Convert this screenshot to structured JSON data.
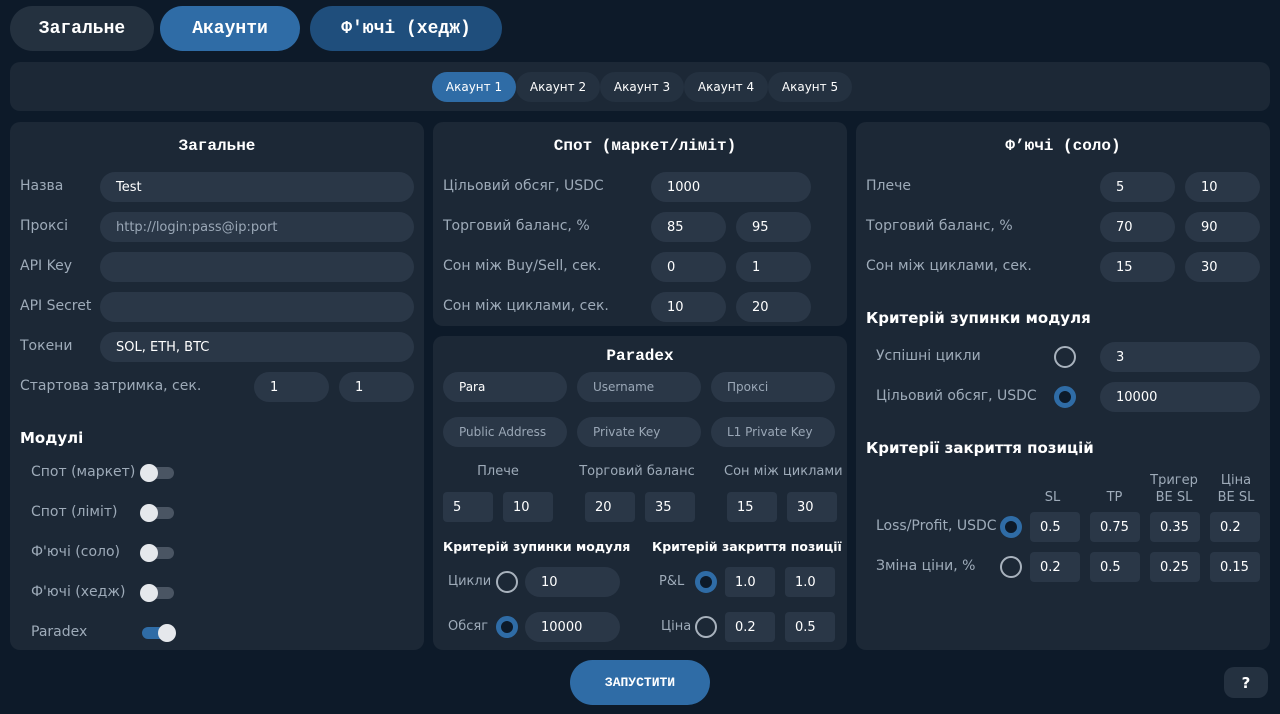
{
  "tabs": {
    "general": "Загальне",
    "accounts": "Акаунти",
    "futures_hedge": "Ф'ючі (хедж)"
  },
  "account_tabs": [
    "Акаунт 1",
    "Акаунт 2",
    "Акаунт 3",
    "Акаунт 4",
    "Акаунт 5"
  ],
  "general": {
    "title": "Загальне",
    "name_label": "Назва",
    "name_value": "Test",
    "proxy_label": "Проксі",
    "proxy_placeholder": "http://login:pass@ip:port",
    "api_key_label": "API Key",
    "api_key_value": "",
    "api_secret_label": "API Secret",
    "api_secret_value": "",
    "tokens_label": "Токени",
    "tokens_value": "SOL, ETH, BTC",
    "start_delay_label": "Стартова затримка, сек.",
    "start_delay_min": "1",
    "start_delay_max": "1",
    "modules_title": "Модулі",
    "modules": [
      {
        "label": "Спот (маркет)",
        "on": false
      },
      {
        "label": "Спот (ліміт)",
        "on": false
      },
      {
        "label": "Ф'ючі (соло)",
        "on": false
      },
      {
        "label": "Ф'ючі (хедж)",
        "on": false
      },
      {
        "label": "Paradex",
        "on": true
      }
    ]
  },
  "spot": {
    "title": "Спот (маркет/ліміт)",
    "target_volume_label": "Цільовий обсяг, USDC",
    "target_volume": "1000",
    "trade_balance_label": "Торговий баланс, %",
    "trade_balance_min": "85",
    "trade_balance_max": "95",
    "sleep_buy_sell_label": "Сон між Buy/Sell, сек.",
    "sleep_buy_sell_min": "0",
    "sleep_buy_sell_max": "1",
    "sleep_cycles_label": "Сон між циклами, сек.",
    "sleep_cycles_min": "10",
    "sleep_cycles_max": "20"
  },
  "paradex": {
    "title": "Paradex",
    "para_placeholder": "Para",
    "username_placeholder": "Username",
    "proxy_placeholder": "Проксі",
    "public_address_placeholder": "Public Address",
    "private_key_placeholder": "Private Key",
    "l1_private_key_placeholder": "L1 Private Key",
    "leverage_label": "Плече",
    "leverage_min": "5",
    "leverage_max": "10",
    "trade_balance_label": "Торговий баланс",
    "trade_balance_min": "20",
    "trade_balance_max": "35",
    "sleep_label": "Сон між циклами",
    "sleep_min": "15",
    "sleep_max": "30",
    "stop_title": "Критерій зупинки модуля",
    "cycles_label": "Цикли",
    "cycles_value": "10",
    "volume_label": "Обсяг",
    "volume_value": "10000",
    "close_title": "Критерій закриття позиції",
    "pnl_label": "P&L",
    "pnl_min": "1.0",
    "pnl_max": "1.0",
    "price_label": "Ціна",
    "price_min": "0.2",
    "price_max": "0.5"
  },
  "futures": {
    "title": "Ф’ючі (соло)",
    "leverage_label": "Плече",
    "leverage_min": "5",
    "leverage_max": "10",
    "trade_balance_label": "Торговий баланс, %",
    "trade_balance_min": "70",
    "trade_balance_max": "90",
    "sleep_label": "Сон між циклами, сек.",
    "sleep_min": "15",
    "sleep_max": "30",
    "stop_title": "Критерій зупинки модуля",
    "success_cycles_label": "Успішні цикли",
    "success_cycles_value": "3",
    "target_volume_label": "Цільовий обсяг, USDC",
    "target_volume_value": "10000",
    "close_title": "Критерії закриття позицій",
    "col_sl": "SL",
    "col_tp": "TP",
    "col_trigger_line1": "Тригер",
    "col_trigger_line2": "BE SL",
    "col_price_line1": "Ціна",
    "col_price_line2": "BE SL",
    "loss_profit_label": "Loss/Profit, USDC",
    "lp_sl": "0.5",
    "lp_tp": "0.75",
    "lp_trigger": "0.35",
    "lp_price": "0.2",
    "price_change_label": "Зміна ціни, %",
    "pc_sl": "0.2",
    "pc_tp": "0.5",
    "pc_trigger": "0.25",
    "pc_price": "0.15"
  },
  "start_button": "ЗАПУСТИТИ",
  "help_button": "?",
  "colors": {
    "background": "#0d1a29",
    "panel": "#1c2836",
    "input": "#2a3747",
    "accent": "#2f6ca6"
  }
}
